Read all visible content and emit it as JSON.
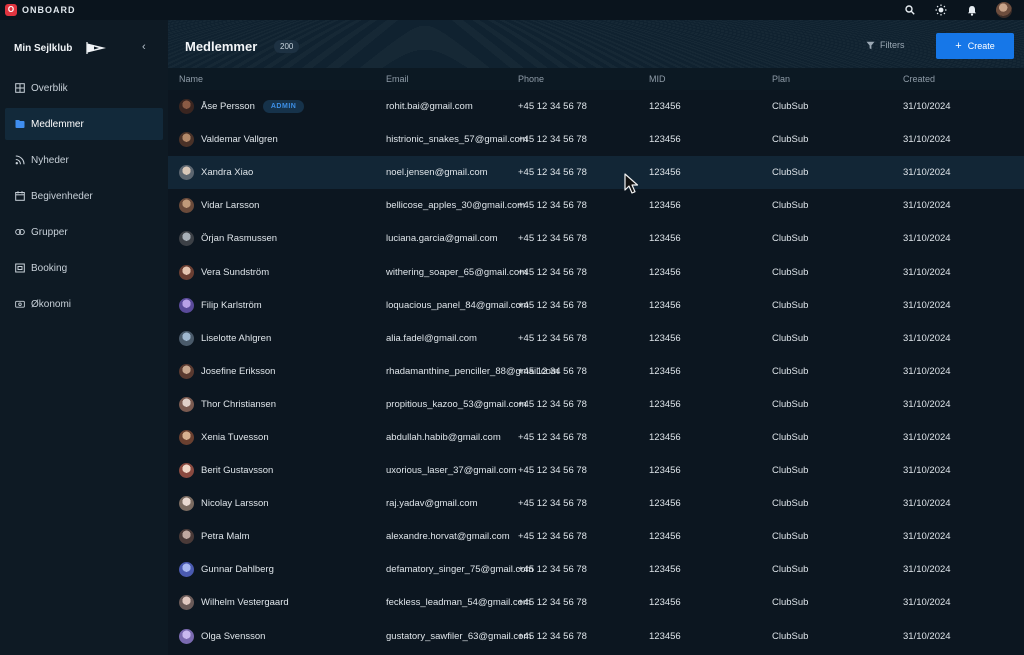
{
  "topbar": {
    "brand_logo": "O",
    "brand_name": "ONBOARD",
    "icons": [
      "search-icon",
      "sun-icon",
      "bell-icon",
      "user-avatar"
    ]
  },
  "sidebar": {
    "club_name": "Min Sejlklub",
    "collapse_glyph": "‹",
    "items": [
      {
        "label": "Overblik",
        "icon": "grid-icon"
      },
      {
        "label": "Medlemmer",
        "icon": "users-icon",
        "active": true
      },
      {
        "label": "Nyheder",
        "icon": "rss-icon"
      },
      {
        "label": "Begivenheder",
        "icon": "calendar-icon"
      },
      {
        "label": "Grupper",
        "icon": "groups-icon"
      },
      {
        "label": "Booking",
        "icon": "booking-icon"
      },
      {
        "label": "Økonomi",
        "icon": "wallet-icon"
      }
    ]
  },
  "header": {
    "title": "Medlemmer",
    "count": "200",
    "filters_label": "Filters",
    "create_label": "Create"
  },
  "table": {
    "columns": {
      "name": "Name",
      "email": "Email",
      "phone": "Phone",
      "mid": "MID",
      "plan": "Plan",
      "created": "Created"
    },
    "admin_label": "ADMIN",
    "rows": [
      {
        "name": "Åse Persson",
        "email": "rohit.bai@gmail.com",
        "phone": "+45 12 34 56 78",
        "mid": "123456",
        "plan": "ClubSub",
        "created": "31/10/2024"
      },
      {
        "name": "Valdemar Vallgren",
        "email": "histrionic_snakes_57@gmail.com",
        "phone": "+45 12 34 56 78",
        "mid": "123456",
        "plan": "ClubSub",
        "created": "31/10/2024"
      },
      {
        "name": "Xandra Xiao",
        "email": "noel.jensen@gmail.com",
        "phone": "+45 12 34 56 78",
        "mid": "123456",
        "plan": "ClubSub",
        "created": "31/10/2024"
      },
      {
        "name": "Vidar Larsson",
        "email": "bellicose_apples_30@gmail.com",
        "phone": "+45 12 34 56 78",
        "mid": "123456",
        "plan": "ClubSub",
        "created": "31/10/2024"
      },
      {
        "name": "Örjan Rasmussen",
        "email": "luciana.garcia@gmail.com",
        "phone": "+45 12 34 56 78",
        "mid": "123456",
        "plan": "ClubSub",
        "created": "31/10/2024"
      },
      {
        "name": "Vera Sundström",
        "email": "withering_soaper_65@gmail.com",
        "phone": "+45 12 34 56 78",
        "mid": "123456",
        "plan": "ClubSub",
        "created": "31/10/2024"
      },
      {
        "name": "Filip Karlström",
        "email": "loquacious_panel_84@gmail.com",
        "phone": "+45 12 34 56 78",
        "mid": "123456",
        "plan": "ClubSub",
        "created": "31/10/2024"
      },
      {
        "name": "Liselotte Ahlgren",
        "email": "alia.fadel@gmail.com",
        "phone": "+45 12 34 56 78",
        "mid": "123456",
        "plan": "ClubSub",
        "created": "31/10/2024"
      },
      {
        "name": "Josefine Eriksson",
        "email": "rhadamanthine_penciller_88@gmail.com",
        "phone": "+45 12 34 56 78",
        "mid": "123456",
        "plan": "ClubSub",
        "created": "31/10/2024"
      },
      {
        "name": "Thor Christiansen",
        "email": "propitious_kazoo_53@gmail.com",
        "phone": "+45 12 34 56 78",
        "mid": "123456",
        "plan": "ClubSub",
        "created": "31/10/2024"
      },
      {
        "name": "Xenia Tuvesson",
        "email": "abdullah.habib@gmail.com",
        "phone": "+45 12 34 56 78",
        "mid": "123456",
        "plan": "ClubSub",
        "created": "31/10/2024"
      },
      {
        "name": "Berit Gustavsson",
        "email": "uxorious_laser_37@gmail.com",
        "phone": "+45 12 34 56 78",
        "mid": "123456",
        "plan": "ClubSub",
        "created": "31/10/2024"
      },
      {
        "name": "Nicolay Larsson",
        "email": "raj.yadav@gmail.com",
        "phone": "+45 12 34 56 78",
        "mid": "123456",
        "plan": "ClubSub",
        "created": "31/10/2024"
      },
      {
        "name": "Petra Malm",
        "email": "alexandre.horvat@gmail.com",
        "phone": "+45 12 34 56 78",
        "mid": "123456",
        "plan": "ClubSub",
        "created": "31/10/2024"
      },
      {
        "name": "Gunnar Dahlberg",
        "email": "defamatory_singer_75@gmail.com",
        "phone": "+45 12 34 56 78",
        "mid": "123456",
        "plan": "ClubSub",
        "created": "31/10/2024"
      },
      {
        "name": "Wilhelm Vestergaard",
        "email": "feckless_leadman_54@gmail.com",
        "phone": "+45 12 34 56 78",
        "mid": "123456",
        "plan": "ClubSub",
        "created": "31/10/2024"
      },
      {
        "name": "Olga Svensson",
        "email": "gustatory_sawfiler_63@gmail.com",
        "phone": "+45 12 34 56 78",
        "mid": "123456",
        "plan": "ClubSub",
        "created": "31/10/2024"
      }
    ]
  },
  "colors": {
    "accent": "#1677e8",
    "background": "#0c1620",
    "sidebar": "#0e1a24",
    "row_hover": "#122636",
    "brand_red": "#e0343f"
  }
}
